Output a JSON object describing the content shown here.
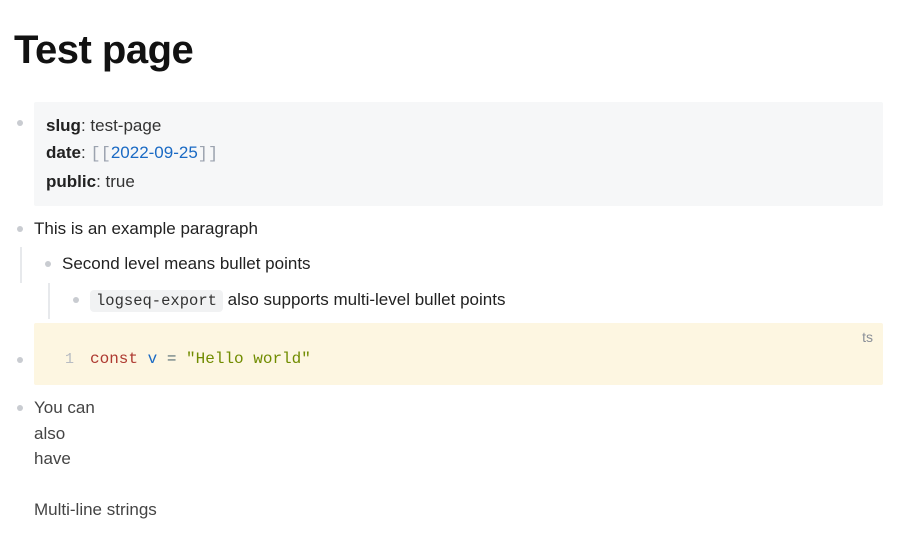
{
  "title": "Test page",
  "frontmatter": {
    "slug_key": "slug",
    "slug_val": "test-page",
    "date_key": "date",
    "date_bracket_open": "[[",
    "date_val": "2022-09-25",
    "date_bracket_close": "]]",
    "public_key": "public",
    "public_val": "true",
    "colon": ": "
  },
  "blocks": {
    "b1": "This is an example paragraph",
    "b2": "Second level means bullet points",
    "b3_code": "logseq-export",
    "b3_rest": " also supports multi-level bullet points",
    "code_lang": "ts",
    "code_ln": "1",
    "code_kw": "const",
    "code_id": " v ",
    "code_op": "= ",
    "code_str": "\"Hello world\"",
    "b4": "You can\nalso\nhave\n\nMulti-line strings"
  }
}
